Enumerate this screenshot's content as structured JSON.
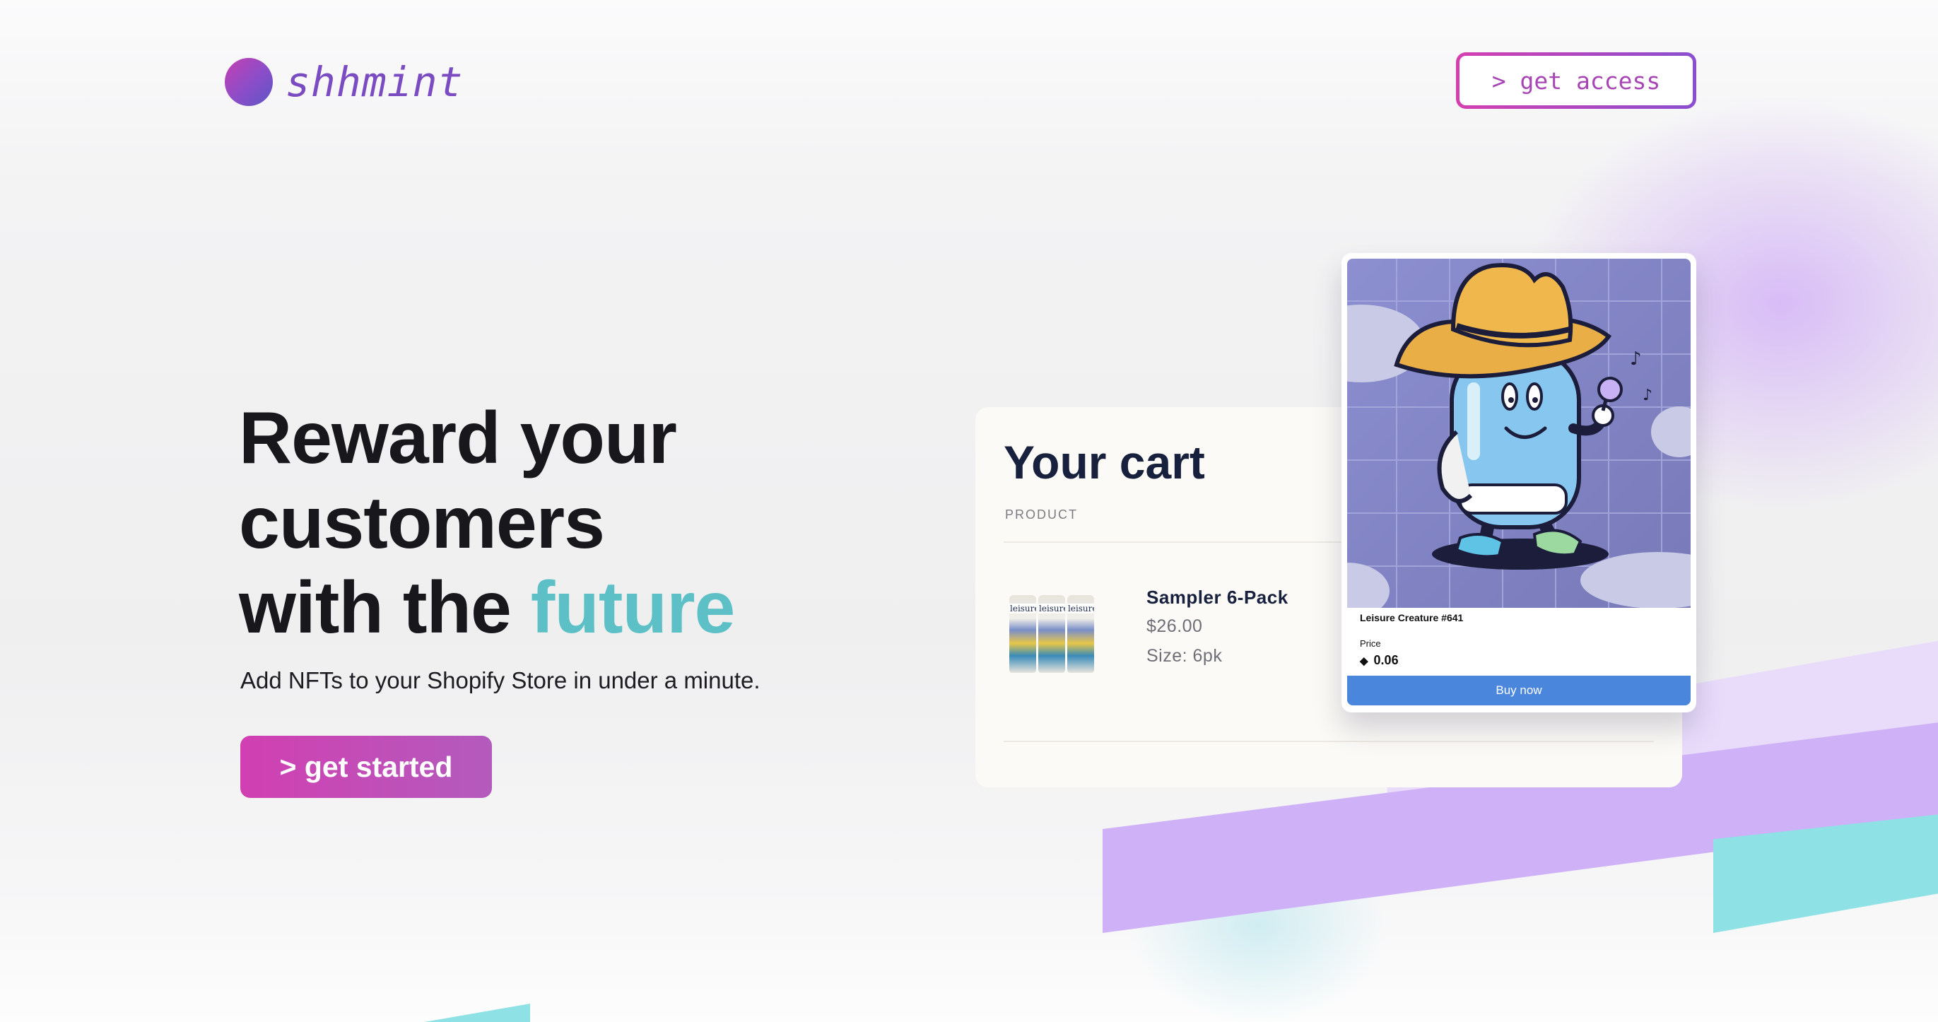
{
  "brand": {
    "name": "shhmint",
    "logo_icon": "gradient-circle-logo"
  },
  "header": {
    "cta_label": "> get access"
  },
  "hero": {
    "title_line1": "Reward your",
    "title_line2": "customers",
    "title_line3_prefix": "with the ",
    "title_line3_accent": "future",
    "subtitle": "Add NFTs to your Shopify Store in under a minute.",
    "cta_label": "> get started"
  },
  "cart": {
    "title": "Your cart",
    "column_header": "PRODUCT",
    "item": {
      "name": "Sampler 6-Pack",
      "price": "$26.00",
      "size": "Size: 6pk",
      "thumbnail_icon": "beer-cans-image"
    }
  },
  "nft_card": {
    "name": "Leisure Creature #641",
    "price_label": "Price",
    "price": "0.06",
    "currency_icon": "ethereum-icon",
    "buy_label": "Buy now",
    "art": "cowboy-can-character-image"
  },
  "colors": {
    "brand_purple": "#7b4bc2",
    "brand_pink": "#d13fb2",
    "accent_teal": "#5cc0c6",
    "buy_blue": "#4b86dd",
    "stripe_lilac": "#cfb1f8",
    "stripe_cyan": "#8ee1e5"
  }
}
